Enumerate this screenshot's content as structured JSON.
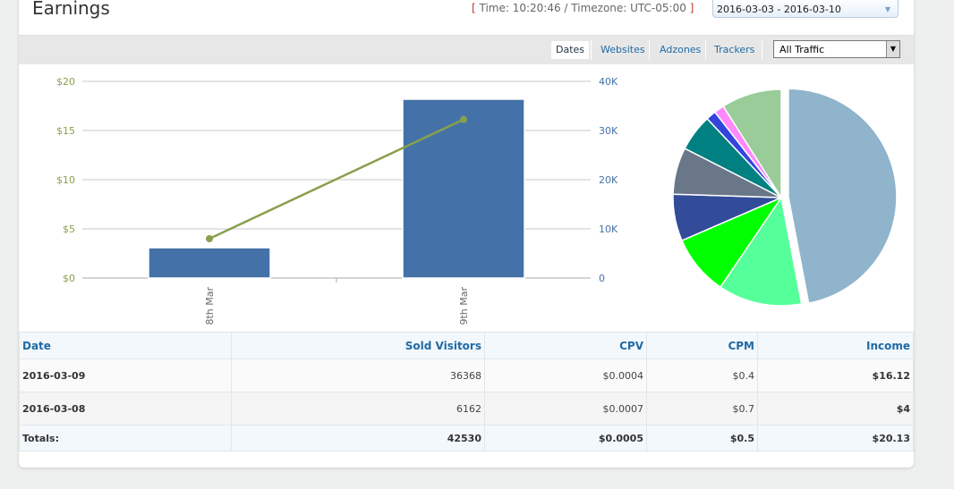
{
  "header": {
    "title": "Earnings",
    "time_label": "Time: 10:20:46 / Timezone: UTC-05:00",
    "date_range": "2016-03-03 - 2016-03-10"
  },
  "tabs": [
    {
      "label": "Dates"
    },
    {
      "label": "Websites"
    },
    {
      "label": "Adzones"
    },
    {
      "label": "Trackers"
    }
  ],
  "traffic_select": "All Traffic",
  "chart_data": [
    {
      "type": "bar+line",
      "categories": [
        "8th Mar",
        "9th Mar"
      ],
      "series": [
        {
          "name": "Sold Visitors",
          "type": "bar",
          "axis": "right",
          "values": [
            6162,
            36368
          ],
          "color": "#4472a8"
        },
        {
          "name": "Income",
          "type": "line",
          "axis": "left",
          "values": [
            4,
            16.12
          ],
          "color": "#88a04c"
        }
      ],
      "left_ticks": [
        "$0",
        "$5",
        "$10",
        "$15",
        "$20"
      ],
      "left_range": [
        0,
        20
      ],
      "right_ticks": [
        "0",
        "10K",
        "20K",
        "30K",
        "40K"
      ],
      "right_range": [
        0,
        40000
      ]
    },
    {
      "type": "pie",
      "values": [
        47,
        12.5,
        9,
        7,
        7,
        5.5,
        1.5,
        1.5,
        9
      ],
      "colors": [
        "#8fb4cc",
        "#55ff99",
        "#00ff00",
        "#334c99",
        "#6a7788",
        "#008080",
        "#3344dd",
        "#ff88ff",
        "#99cc99"
      ]
    }
  ],
  "table": {
    "headers": [
      "Date",
      "Sold Visitors",
      "CPV",
      "CPM",
      "Income"
    ],
    "rows": [
      [
        "2016-03-09",
        "36368",
        "$0.0004",
        "$0.4",
        "$16.12"
      ],
      [
        "2016-03-08",
        "6162",
        "$0.0007",
        "$0.7",
        "$4"
      ]
    ],
    "totals": [
      "Totals:",
      "42530",
      "$0.0005",
      "$0.5",
      "$20.13"
    ]
  }
}
